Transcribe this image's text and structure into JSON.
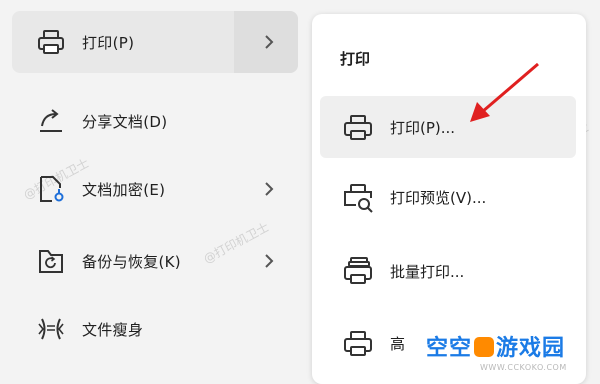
{
  "menu": {
    "items": [
      {
        "label": "打印(P)",
        "icon": "printer-icon",
        "has_submenu": true
      },
      {
        "label": "分享文档(D)",
        "icon": "share-icon",
        "has_submenu": false
      },
      {
        "label": "文档加密(E)",
        "icon": "document-lock-icon",
        "has_submenu": true
      },
      {
        "label": "备份与恢复(K)",
        "icon": "backup-restore-icon",
        "has_submenu": true
      },
      {
        "label": "文件瘦身",
        "icon": "file-slim-icon",
        "has_submenu": false
      }
    ]
  },
  "submenu": {
    "title": "打印",
    "items": [
      {
        "label": "打印(P)...",
        "icon": "printer-icon"
      },
      {
        "label": "打印预览(V)...",
        "icon": "print-preview-icon"
      },
      {
        "label": "批量打印...",
        "icon": "batch-print-icon"
      },
      {
        "label": "高",
        "icon": "printer-icon"
      }
    ]
  },
  "watermark": "@打印机卫士",
  "logo": {
    "brand_left": "空空",
    "brand_right": "游戏园",
    "url": "WWW.CCKOKO.COM"
  },
  "colors": {
    "accent_arrow": "#e02020",
    "brand_blue": "#1b7be6",
    "brand_orange": "#ff8a00"
  }
}
